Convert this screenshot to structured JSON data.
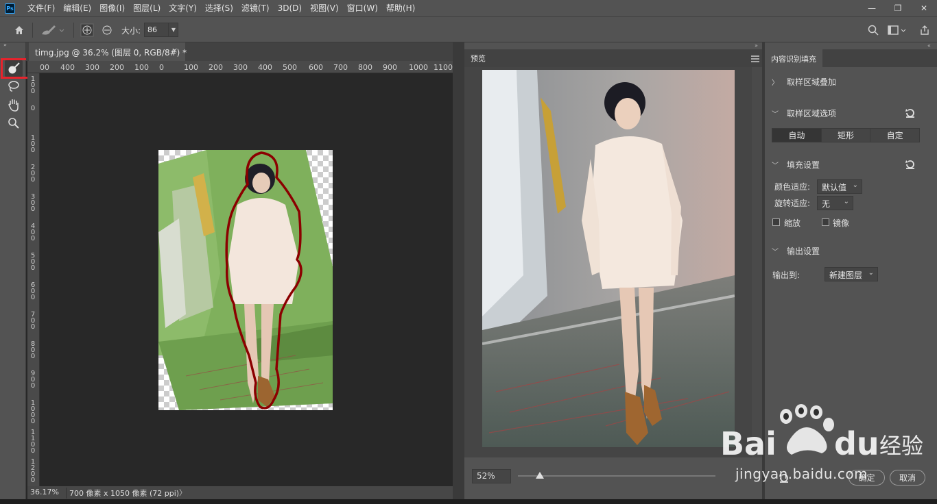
{
  "app": {
    "logo": "Ps",
    "menu": [
      "文件(F)",
      "编辑(E)",
      "图像(I)",
      "图层(L)",
      "文字(Y)",
      "选择(S)",
      "滤镜(T)",
      "3D(D)",
      "视图(V)",
      "窗口(W)",
      "帮助(H)"
    ],
    "window_controls": [
      "—",
      "❐",
      "✕"
    ]
  },
  "options_bar": {
    "size_label": "大小:",
    "size_value": "86"
  },
  "document": {
    "tab_title": "timg.jpg @ 36.2% (图层 0, RGB/8#) *",
    "tab_close": "×",
    "ruler_h": [
      "00",
      "400",
      "300",
      "200",
      "100",
      "0",
      "100",
      "200",
      "300",
      "400",
      "500",
      "600",
      "700",
      "800",
      "900",
      "1000",
      "1100"
    ],
    "ruler_v": [
      "1\n0\n0",
      "0",
      "1\n0\n0",
      "2\n0\n0",
      "3\n0\n0",
      "4\n0\n0",
      "5\n0\n0",
      "6\n0\n0",
      "7\n0\n0",
      "8\n0\n0",
      "9\n0\n0",
      "1\n0\n0\n0",
      "1\n1\n0\n0",
      "1\n2\n0\n0"
    ],
    "status_zoom": "36.17%",
    "status_info": "700 像素 x 1050 像素 (72 ppi)",
    "status_arrow": "〉"
  },
  "preview": {
    "title": "预览",
    "zoom": "52%",
    "zoom_level": 0.11
  },
  "content_fill": {
    "tab": "内容识别填充",
    "sampling_overlay": "取样区域叠加",
    "sampling_options": "取样区域选项",
    "modes": [
      "自动",
      "矩形",
      "自定"
    ],
    "active_mode": "自动",
    "fill_settings": "填充设置",
    "color_adapt_label": "颜色适应:",
    "color_adapt_value": "默认值",
    "rotate_adapt_label": "旋转适应:",
    "rotate_adapt_value": "无",
    "scale_label": "缩放",
    "mirror_label": "镜像",
    "output_settings": "输出设置",
    "output_to_label": "输出到:",
    "output_to_value": "新建图层",
    "ok": "确定",
    "cancel": "取消"
  },
  "watermark": {
    "brand": "Bai",
    "brand_suffix": "du",
    "product": "经验",
    "url": "jingyan.baidu.com"
  },
  "colors": {
    "panel": "#535353",
    "canvas": "#282828",
    "highlight": "#e8232c",
    "selection": "#8b0000"
  }
}
